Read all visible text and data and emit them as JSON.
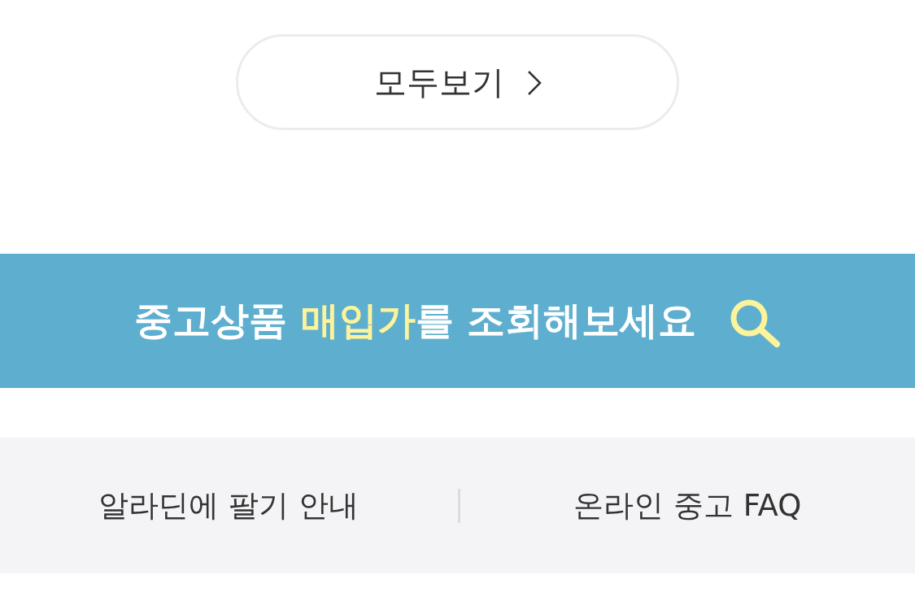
{
  "view_all_button": {
    "label": "모두보기"
  },
  "banner": {
    "parts": [
      {
        "text": "중고상품 ",
        "highlight": false
      },
      {
        "text": "매입가",
        "highlight": true
      },
      {
        "text": "를 조회해보세요",
        "highlight": false
      }
    ]
  },
  "footer_links": [
    {
      "label": "알라딘에 팔기 안내"
    },
    {
      "label": "온라인 중고 FAQ"
    }
  ]
}
